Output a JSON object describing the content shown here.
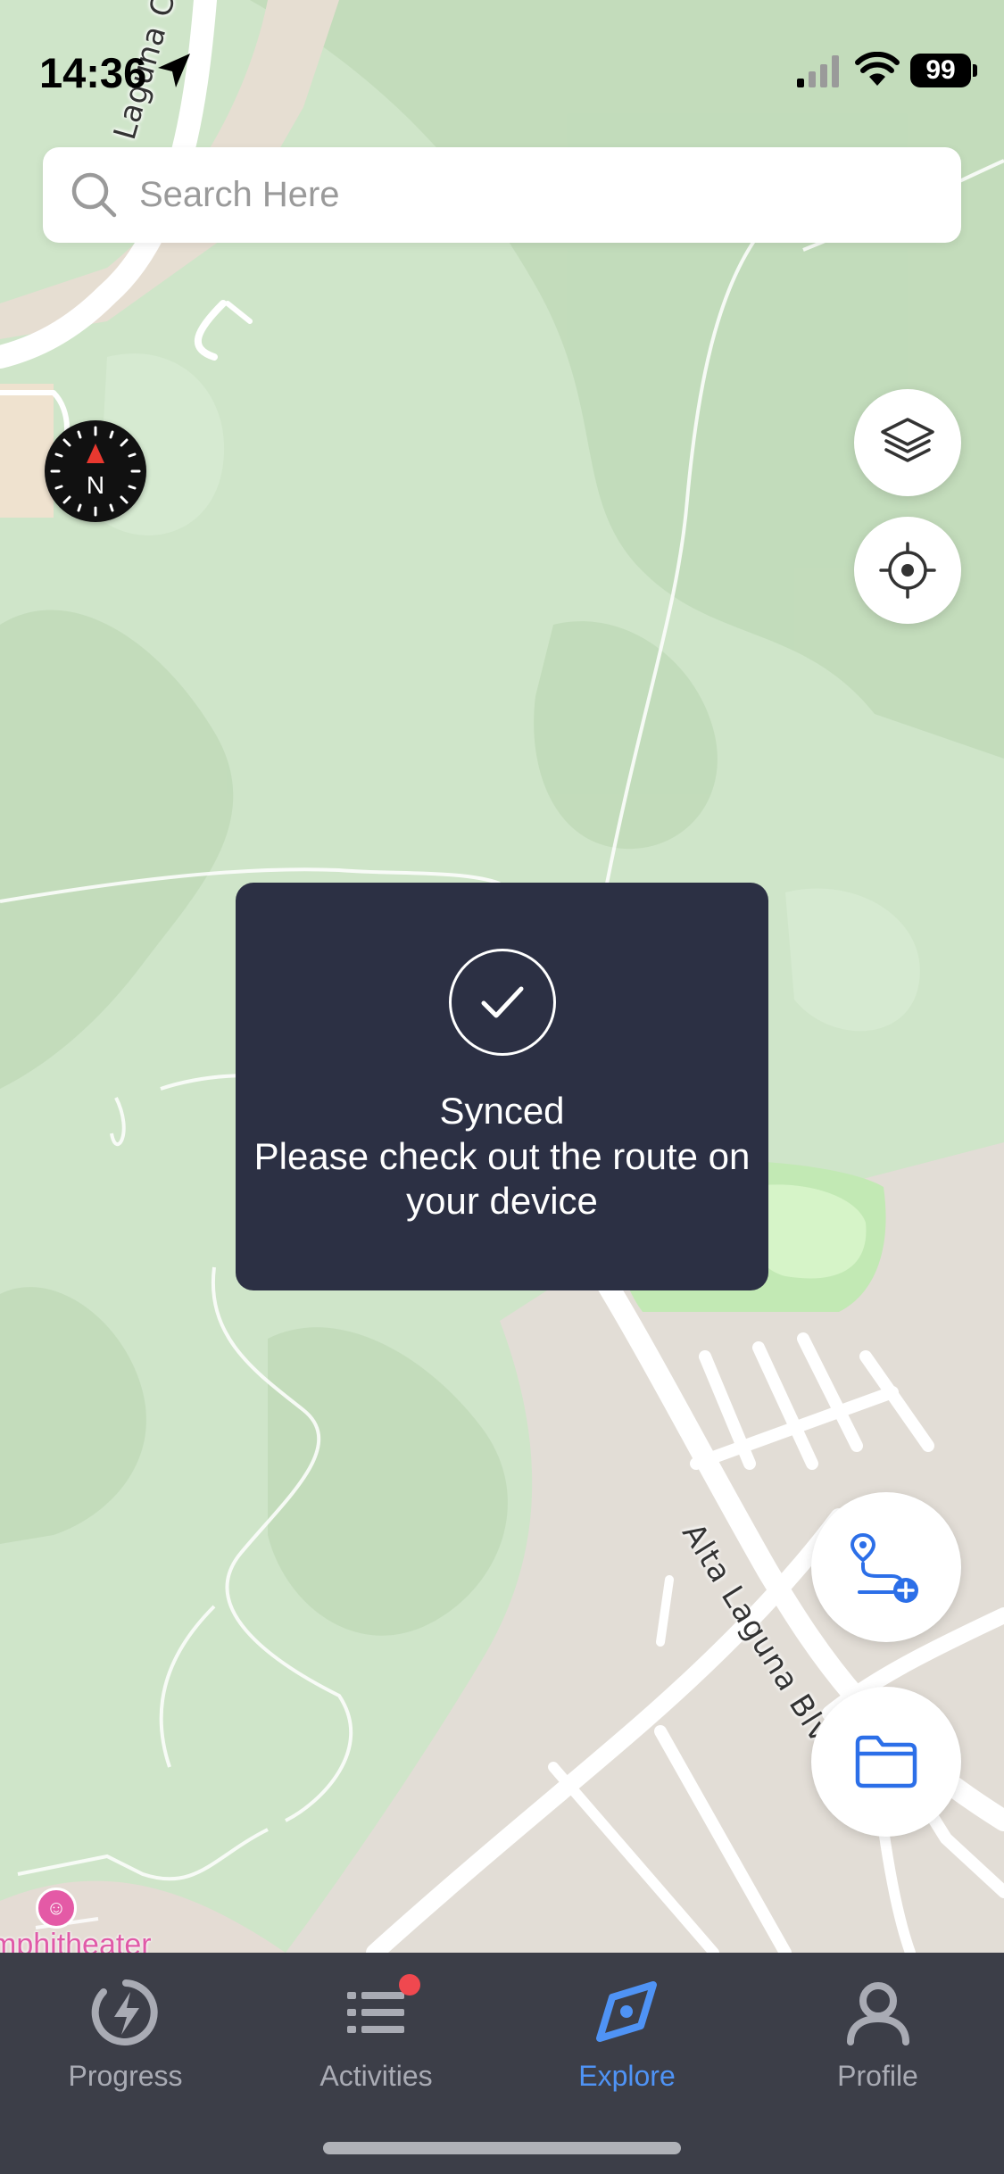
{
  "status_bar": {
    "time": "14:36",
    "battery": "99"
  },
  "search": {
    "placeholder": "Search Here"
  },
  "map": {
    "road_labels": {
      "canyon": "Laguna Canyon Rd",
      "alta": "Alta Laguna Blvd"
    },
    "poi_label": "mphitheater",
    "compass_letter": "N"
  },
  "toast": {
    "title": "Synced",
    "message": "Please check out the route on your device"
  },
  "tabs": [
    {
      "label": "Progress",
      "icon": "lightning-circle-icon",
      "active": false
    },
    {
      "label": "Activities",
      "icon": "list-icon",
      "active": false,
      "badge": true
    },
    {
      "label": "Explore",
      "icon": "compass-icon",
      "active": true
    },
    {
      "label": "Profile",
      "icon": "person-icon",
      "active": false
    }
  ],
  "colors": {
    "accent": "#4f93f5",
    "tab_bar": "#3c3e48",
    "toast_bg": "#2c3044",
    "badge": "#f0484f",
    "map_green": "#cfe5c9"
  }
}
